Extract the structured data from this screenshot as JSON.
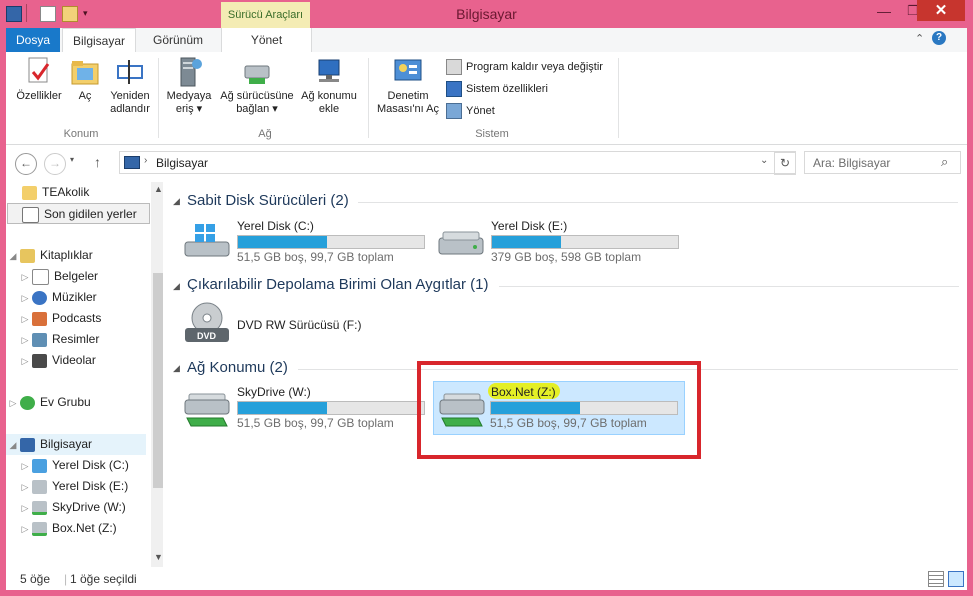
{
  "window": {
    "title": "Bilgisayar",
    "context_tab": "Sürücü Araçları"
  },
  "ribbon_tabs": {
    "dosya": "Dosya",
    "bilgisayar": "Bilgisayar",
    "gorunum": "Görünüm",
    "yonet": "Yönet"
  },
  "ribbon": {
    "konum": {
      "ozellikler": "Özellikler",
      "ac": "Aç",
      "yeniden_1": "Yeniden",
      "yeniden_2": "adlandır",
      "label": "Konum"
    },
    "ag": {
      "medya_1": "Medyaya",
      "medya_2": "eriş ▾",
      "surucu_1": "Ağ sürücüsüne",
      "surucu_2": "bağlan ▾",
      "konum_1": "Ağ konumu",
      "konum_2": "ekle",
      "label": "Ağ"
    },
    "sistem": {
      "denetim_1": "Denetim",
      "denetim_2": "Masası'nı Aç",
      "program": "Program kaldır veya değiştir",
      "sistem_ozel": "Sistem özellikleri",
      "yonet": "Yönet",
      "label": "Sistem"
    }
  },
  "address": {
    "path": "Bilgisayar",
    "search_placeholder": "Ara: Bilgisayar"
  },
  "nav": {
    "teakolik": "TEAkolik",
    "son": "Son gidilen yerler",
    "kitapliklar": "Kitaplıklar",
    "belgeler": "Belgeler",
    "muzikler": "Müzikler",
    "podcasts": "Podcasts",
    "resimler": "Resimler",
    "videolar": "Videolar",
    "evgrubu": "Ev Grubu",
    "bilgisayar": "Bilgisayar",
    "c": "Yerel Disk (C:)",
    "e": "Yerel Disk (E:)",
    "w": "SkyDrive (W:)",
    "z": "Box.Net (Z:)"
  },
  "groups": {
    "hdd": "Sabit Disk Sürücüleri (2)",
    "removable": "Çıkarılabilir Depolama Birimi Olan Aygıtlar (1)",
    "network": "Ağ Konumu (2)"
  },
  "drives": {
    "c": {
      "name": "Yerel Disk (C:)",
      "free": "51,5 GB boş, 99,7 GB toplam",
      "used_fraction": 0.48
    },
    "e": {
      "name": "Yerel Disk (E:)",
      "free": "379 GB boş, 598 GB toplam",
      "used_fraction": 0.37
    },
    "f": {
      "name": "DVD RW Sürücüsü (F:)"
    },
    "w": {
      "name": "SkyDrive (W:)",
      "free": "51,5 GB boş, 99,7 GB toplam",
      "used_fraction": 0.48
    },
    "z": {
      "name": "Box.Net (Z:)",
      "free": "51,5 GB boş, 99,7 GB toplam",
      "used_fraction": 0.48
    }
  },
  "status": {
    "count": "5 öğe",
    "selected": "1 öğe seçildi"
  },
  "colors": {
    "accent": "#1979ca",
    "bar_fill": "#26a0da",
    "highlight_frame": "#d8262c",
    "marker": "#e8f000"
  }
}
